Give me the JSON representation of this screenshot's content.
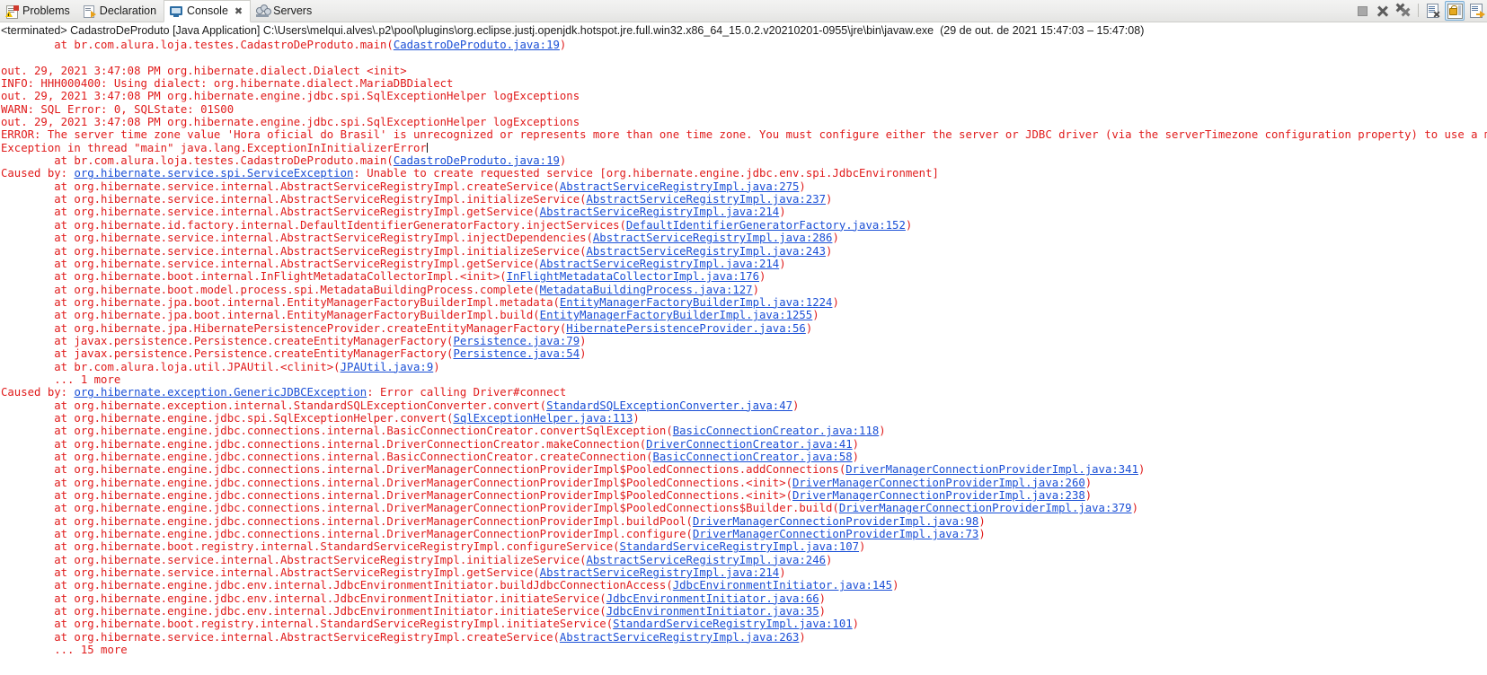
{
  "window": {
    "title": "Console",
    "accent": "#2b6ca3",
    "error_color": "#e01b1b",
    "link_color": "#1a4fd6"
  },
  "tabbar": {
    "tabs": [
      {
        "label": "Problems",
        "icon": "problems-icon",
        "active": false,
        "closable": false
      },
      {
        "label": "Declaration",
        "icon": "declaration-icon",
        "active": false,
        "closable": false
      },
      {
        "label": "Console",
        "icon": "console-icon",
        "active": true,
        "closable": true,
        "close_glyph": "✖"
      },
      {
        "label": "Servers",
        "icon": "servers-icon",
        "active": false,
        "closable": false
      }
    ],
    "toolbar": [
      {
        "name": "terminate-button",
        "tooltip": "Terminate",
        "selected": false
      },
      {
        "name": "remove-launch-button",
        "tooltip": "Remove Launch",
        "selected": false
      },
      {
        "name": "remove-all-terminated-launches-button",
        "tooltip": "Remove All Terminated Launches",
        "selected": false
      },
      {
        "name": "clear-console-button",
        "tooltip": "Clear Console",
        "selected": false
      },
      {
        "name": "scroll-lock-button",
        "tooltip": "Scroll Lock",
        "selected": true
      },
      {
        "name": "pin-console-button",
        "tooltip": "Pin Console",
        "selected": false
      }
    ]
  },
  "console": {
    "launch_header": "<terminated> CadastroDeProduto [Java Application] C:\\Users\\melqui.alves\\.p2\\pool\\plugins\\org.eclipse.justj.openjdk.hotspot.jre.full.win32.x86_64_15.0.2.v20210201-0955\\jre\\bin\\javaw.exe  (29 de out. de 2021 15:47:03 – 15:47:08)",
    "lines": [
      {
        "indent": "\t",
        "text": "at br.com.alura.loja.testes.CadastroDeProduto.main(",
        "link": "CadastroDeProduto.java:19",
        "tail": ")"
      },
      {
        "text": ""
      },
      {
        "text": "out. 29, 2021 3:47:08 PM org.hibernate.dialect.Dialect <init>"
      },
      {
        "text": "INFO: HHH000400: Using dialect: org.hibernate.dialect.MariaDBDialect"
      },
      {
        "text": "out. 29, 2021 3:47:08 PM org.hibernate.engine.jdbc.spi.SqlExceptionHelper logExceptions"
      },
      {
        "text": "WARN: SQL Error: 0, SQLState: 01S00"
      },
      {
        "text": "out. 29, 2021 3:47:08 PM org.hibernate.engine.jdbc.spi.SqlExceptionHelper logExceptions"
      },
      {
        "text": "ERROR: The server time zone value 'Hora oficial do Brasil' is unrecognized or represents more than one time zone. You must configure either the server or JDBC driver (via the serverTimezone configuration property) to use a more specifc"
      },
      {
        "text": "Exception in thread \"main\" java.lang.ExceptionInInitializerError",
        "caret": true
      },
      {
        "indent": "\t",
        "text": "at br.com.alura.loja.testes.CadastroDeProduto.main(",
        "link": "CadastroDeProduto.java:19",
        "tail": ")"
      },
      {
        "text": "Caused by: ",
        "link": "org.hibernate.service.spi.ServiceException",
        "tail": ": Unable to create requested service [org.hibernate.engine.jdbc.env.spi.JdbcEnvironment]"
      },
      {
        "indent": "\t",
        "text": "at org.hibernate.service.internal.AbstractServiceRegistryImpl.createService(",
        "link": "AbstractServiceRegistryImpl.java:275",
        "tail": ")"
      },
      {
        "indent": "\t",
        "text": "at org.hibernate.service.internal.AbstractServiceRegistryImpl.initializeService(",
        "link": "AbstractServiceRegistryImpl.java:237",
        "tail": ")"
      },
      {
        "indent": "\t",
        "text": "at org.hibernate.service.internal.AbstractServiceRegistryImpl.getService(",
        "link": "AbstractServiceRegistryImpl.java:214",
        "tail": ")"
      },
      {
        "indent": "\t",
        "text": "at org.hibernate.id.factory.internal.DefaultIdentifierGeneratorFactory.injectServices(",
        "link": "DefaultIdentifierGeneratorFactory.java:152",
        "tail": ")"
      },
      {
        "indent": "\t",
        "text": "at org.hibernate.service.internal.AbstractServiceRegistryImpl.injectDependencies(",
        "link": "AbstractServiceRegistryImpl.java:286",
        "tail": ")"
      },
      {
        "indent": "\t",
        "text": "at org.hibernate.service.internal.AbstractServiceRegistryImpl.initializeService(",
        "link": "AbstractServiceRegistryImpl.java:243",
        "tail": ")"
      },
      {
        "indent": "\t",
        "text": "at org.hibernate.service.internal.AbstractServiceRegistryImpl.getService(",
        "link": "AbstractServiceRegistryImpl.java:214",
        "tail": ")"
      },
      {
        "indent": "\t",
        "text": "at org.hibernate.boot.internal.InFlightMetadataCollectorImpl.<init>(",
        "link": "InFlightMetadataCollectorImpl.java:176",
        "tail": ")"
      },
      {
        "indent": "\t",
        "text": "at org.hibernate.boot.model.process.spi.MetadataBuildingProcess.complete(",
        "link": "MetadataBuildingProcess.java:127",
        "tail": ")"
      },
      {
        "indent": "\t",
        "text": "at org.hibernate.jpa.boot.internal.EntityManagerFactoryBuilderImpl.metadata(",
        "link": "EntityManagerFactoryBuilderImpl.java:1224",
        "tail": ")"
      },
      {
        "indent": "\t",
        "text": "at org.hibernate.jpa.boot.internal.EntityManagerFactoryBuilderImpl.build(",
        "link": "EntityManagerFactoryBuilderImpl.java:1255",
        "tail": ")"
      },
      {
        "indent": "\t",
        "text": "at org.hibernate.jpa.HibernatePersistenceProvider.createEntityManagerFactory(",
        "link": "HibernatePersistenceProvider.java:56",
        "tail": ")"
      },
      {
        "indent": "\t",
        "text": "at javax.persistence.Persistence.createEntityManagerFactory(",
        "link": "Persistence.java:79",
        "tail": ")"
      },
      {
        "indent": "\t",
        "text": "at javax.persistence.Persistence.createEntityManagerFactory(",
        "link": "Persistence.java:54",
        "tail": ")"
      },
      {
        "indent": "\t",
        "text": "at br.com.alura.loja.util.JPAUtil.<clinit>(",
        "link": "JPAUtil.java:9",
        "tail": ")"
      },
      {
        "indent": "\t",
        "text": "... 1 more"
      },
      {
        "text": "Caused by: ",
        "link": "org.hibernate.exception.GenericJDBCException",
        "tail": ": Error calling Driver#connect"
      },
      {
        "indent": "\t",
        "text": "at org.hibernate.exception.internal.StandardSQLExceptionConverter.convert(",
        "link": "StandardSQLExceptionConverter.java:47",
        "tail": ")"
      },
      {
        "indent": "\t",
        "text": "at org.hibernate.engine.jdbc.spi.SqlExceptionHelper.convert(",
        "link": "SqlExceptionHelper.java:113",
        "tail": ")"
      },
      {
        "indent": "\t",
        "text": "at org.hibernate.engine.jdbc.connections.internal.BasicConnectionCreator.convertSqlException(",
        "link": "BasicConnectionCreator.java:118",
        "tail": ")"
      },
      {
        "indent": "\t",
        "text": "at org.hibernate.engine.jdbc.connections.internal.DriverConnectionCreator.makeConnection(",
        "link": "DriverConnectionCreator.java:41",
        "tail": ")"
      },
      {
        "indent": "\t",
        "text": "at org.hibernate.engine.jdbc.connections.internal.BasicConnectionCreator.createConnection(",
        "link": "BasicConnectionCreator.java:58",
        "tail": ")"
      },
      {
        "indent": "\t",
        "text": "at org.hibernate.engine.jdbc.connections.internal.DriverManagerConnectionProviderImpl$PooledConnections.addConnections(",
        "link": "DriverManagerConnectionProviderImpl.java:341",
        "tail": ")"
      },
      {
        "indent": "\t",
        "text": "at org.hibernate.engine.jdbc.connections.internal.DriverManagerConnectionProviderImpl$PooledConnections.<init>(",
        "link": "DriverManagerConnectionProviderImpl.java:260",
        "tail": ")"
      },
      {
        "indent": "\t",
        "text": "at org.hibernate.engine.jdbc.connections.internal.DriverManagerConnectionProviderImpl$PooledConnections.<init>(",
        "link": "DriverManagerConnectionProviderImpl.java:238",
        "tail": ")"
      },
      {
        "indent": "\t",
        "text": "at org.hibernate.engine.jdbc.connections.internal.DriverManagerConnectionProviderImpl$PooledConnections$Builder.build(",
        "link": "DriverManagerConnectionProviderImpl.java:379",
        "tail": ")"
      },
      {
        "indent": "\t",
        "text": "at org.hibernate.engine.jdbc.connections.internal.DriverManagerConnectionProviderImpl.buildPool(",
        "link": "DriverManagerConnectionProviderImpl.java:98",
        "tail": ")"
      },
      {
        "indent": "\t",
        "text": "at org.hibernate.engine.jdbc.connections.internal.DriverManagerConnectionProviderImpl.configure(",
        "link": "DriverManagerConnectionProviderImpl.java:73",
        "tail": ")"
      },
      {
        "indent": "\t",
        "text": "at org.hibernate.boot.registry.internal.StandardServiceRegistryImpl.configureService(",
        "link": "StandardServiceRegistryImpl.java:107",
        "tail": ")"
      },
      {
        "indent": "\t",
        "text": "at org.hibernate.service.internal.AbstractServiceRegistryImpl.initializeService(",
        "link": "AbstractServiceRegistryImpl.java:246",
        "tail": ")"
      },
      {
        "indent": "\t",
        "text": "at org.hibernate.service.internal.AbstractServiceRegistryImpl.getService(",
        "link": "AbstractServiceRegistryImpl.java:214",
        "tail": ")"
      },
      {
        "indent": "\t",
        "text": "at org.hibernate.engine.jdbc.env.internal.JdbcEnvironmentInitiator.buildJdbcConnectionAccess(",
        "link": "JdbcEnvironmentInitiator.java:145",
        "tail": ")"
      },
      {
        "indent": "\t",
        "text": "at org.hibernate.engine.jdbc.env.internal.JdbcEnvironmentInitiator.initiateService(",
        "link": "JdbcEnvironmentInitiator.java:66",
        "tail": ")"
      },
      {
        "indent": "\t",
        "text": "at org.hibernate.engine.jdbc.env.internal.JdbcEnvironmentInitiator.initiateService(",
        "link": "JdbcEnvironmentInitiator.java:35",
        "tail": ")"
      },
      {
        "indent": "\t",
        "text": "at org.hibernate.boot.registry.internal.StandardServiceRegistryImpl.initiateService(",
        "link": "StandardServiceRegistryImpl.java:101",
        "tail": ")"
      },
      {
        "indent": "\t",
        "text": "at org.hibernate.service.internal.AbstractServiceRegistryImpl.createService(",
        "link": "AbstractServiceRegistryImpl.java:263",
        "tail": ")"
      },
      {
        "indent": "\t",
        "text": "... 15 more"
      }
    ]
  }
}
